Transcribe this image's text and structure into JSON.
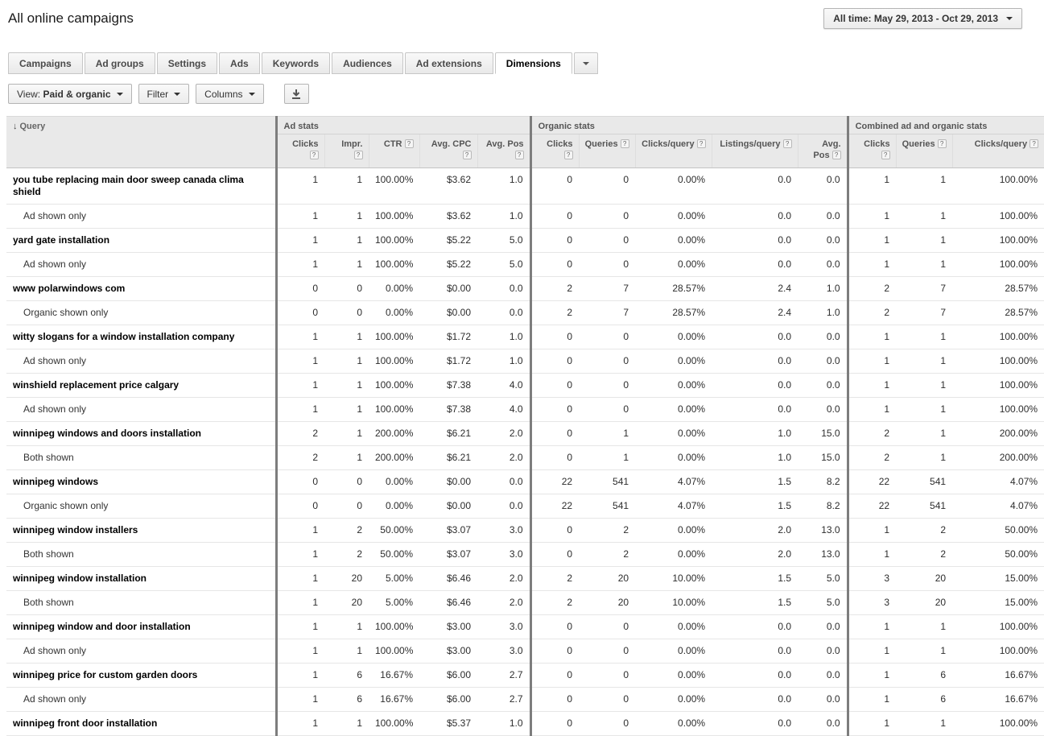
{
  "page": {
    "title": "All online campaigns",
    "date_range_label": "All time: May 29, 2013 - Oct 29, 2013"
  },
  "icons": {
    "sort_desc": "↓",
    "caret_down": "▾",
    "help": "?",
    "download": "download-icon"
  },
  "tabs": [
    {
      "label": "Campaigns",
      "selected": false
    },
    {
      "label": "Ad groups",
      "selected": false
    },
    {
      "label": "Settings",
      "selected": false
    },
    {
      "label": "Ads",
      "selected": false
    },
    {
      "label": "Keywords",
      "selected": false
    },
    {
      "label": "Audiences",
      "selected": false
    },
    {
      "label": "Ad extensions",
      "selected": false
    },
    {
      "label": "Dimensions",
      "selected": true
    },
    {
      "label": "▼",
      "selected": false,
      "is_more": true
    }
  ],
  "toolbar": {
    "view_label_prefix": "View: ",
    "view_value": "Paid & organic",
    "filter_label": "Filter",
    "columns_label": "Columns"
  },
  "table": {
    "query_header": "Query",
    "groups": [
      {
        "label": "Ad stats",
        "columns": [
          "Clicks",
          "Impr.",
          "CTR",
          "Avg. CPC",
          "Avg. Pos"
        ]
      },
      {
        "label": "Organic stats",
        "columns": [
          "Clicks",
          "Queries",
          "Clicks/query",
          "Listings/query",
          "Avg. Pos"
        ]
      },
      {
        "label": "Combined ad and organic stats",
        "columns": [
          "Clicks",
          "Queries",
          "Clicks/query"
        ]
      }
    ],
    "rows": [
      {
        "query": "you tube replacing main door sweep canada clima shield",
        "level": "query",
        "values": [
          "1",
          "1",
          "100.00%",
          "$3.62",
          "1.0",
          "0",
          "0",
          "0.00%",
          "0.0",
          "0.0",
          "1",
          "1",
          "100.00%"
        ]
      },
      {
        "query": "Ad shown only",
        "level": "segment",
        "values": [
          "1",
          "1",
          "100.00%",
          "$3.62",
          "1.0",
          "0",
          "0",
          "0.00%",
          "0.0",
          "0.0",
          "1",
          "1",
          "100.00%"
        ]
      },
      {
        "query": "yard gate installation",
        "level": "query",
        "values": [
          "1",
          "1",
          "100.00%",
          "$5.22",
          "5.0",
          "0",
          "0",
          "0.00%",
          "0.0",
          "0.0",
          "1",
          "1",
          "100.00%"
        ]
      },
      {
        "query": "Ad shown only",
        "level": "segment",
        "values": [
          "1",
          "1",
          "100.00%",
          "$5.22",
          "5.0",
          "0",
          "0",
          "0.00%",
          "0.0",
          "0.0",
          "1",
          "1",
          "100.00%"
        ]
      },
      {
        "query": "www polarwindows com",
        "level": "query",
        "values": [
          "0",
          "0",
          "0.00%",
          "$0.00",
          "0.0",
          "2",
          "7",
          "28.57%",
          "2.4",
          "1.0",
          "2",
          "7",
          "28.57%"
        ]
      },
      {
        "query": "Organic shown only",
        "level": "segment",
        "values": [
          "0",
          "0",
          "0.00%",
          "$0.00",
          "0.0",
          "2",
          "7",
          "28.57%",
          "2.4",
          "1.0",
          "2",
          "7",
          "28.57%"
        ]
      },
      {
        "query": "witty slogans for a window installation company",
        "level": "query",
        "values": [
          "1",
          "1",
          "100.00%",
          "$1.72",
          "1.0",
          "0",
          "0",
          "0.00%",
          "0.0",
          "0.0",
          "1",
          "1",
          "100.00%"
        ]
      },
      {
        "query": "Ad shown only",
        "level": "segment",
        "values": [
          "1",
          "1",
          "100.00%",
          "$1.72",
          "1.0",
          "0",
          "0",
          "0.00%",
          "0.0",
          "0.0",
          "1",
          "1",
          "100.00%"
        ]
      },
      {
        "query": "winshield replacement price calgary",
        "level": "query",
        "values": [
          "1",
          "1",
          "100.00%",
          "$7.38",
          "4.0",
          "0",
          "0",
          "0.00%",
          "0.0",
          "0.0",
          "1",
          "1",
          "100.00%"
        ]
      },
      {
        "query": "Ad shown only",
        "level": "segment",
        "values": [
          "1",
          "1",
          "100.00%",
          "$7.38",
          "4.0",
          "0",
          "0",
          "0.00%",
          "0.0",
          "0.0",
          "1",
          "1",
          "100.00%"
        ]
      },
      {
        "query": "winnipeg windows and doors installation",
        "level": "query",
        "values": [
          "2",
          "1",
          "200.00%",
          "$6.21",
          "2.0",
          "0",
          "1",
          "0.00%",
          "1.0",
          "15.0",
          "2",
          "1",
          "200.00%"
        ]
      },
      {
        "query": "Both shown",
        "level": "segment",
        "values": [
          "2",
          "1",
          "200.00%",
          "$6.21",
          "2.0",
          "0",
          "1",
          "0.00%",
          "1.0",
          "15.0",
          "2",
          "1",
          "200.00%"
        ]
      },
      {
        "query": "winnipeg windows",
        "level": "query",
        "values": [
          "0",
          "0",
          "0.00%",
          "$0.00",
          "0.0",
          "22",
          "541",
          "4.07%",
          "1.5",
          "8.2",
          "22",
          "541",
          "4.07%"
        ]
      },
      {
        "query": "Organic shown only",
        "level": "segment",
        "values": [
          "0",
          "0",
          "0.00%",
          "$0.00",
          "0.0",
          "22",
          "541",
          "4.07%",
          "1.5",
          "8.2",
          "22",
          "541",
          "4.07%"
        ]
      },
      {
        "query": "winnipeg window installers",
        "level": "query",
        "values": [
          "1",
          "2",
          "50.00%",
          "$3.07",
          "3.0",
          "0",
          "2",
          "0.00%",
          "2.0",
          "13.0",
          "1",
          "2",
          "50.00%"
        ]
      },
      {
        "query": "Both shown",
        "level": "segment",
        "values": [
          "1",
          "2",
          "50.00%",
          "$3.07",
          "3.0",
          "0",
          "2",
          "0.00%",
          "2.0",
          "13.0",
          "1",
          "2",
          "50.00%"
        ]
      },
      {
        "query": "winnipeg window installation",
        "level": "query",
        "values": [
          "1",
          "20",
          "5.00%",
          "$6.46",
          "2.0",
          "2",
          "20",
          "10.00%",
          "1.5",
          "5.0",
          "3",
          "20",
          "15.00%"
        ]
      },
      {
        "query": "Both shown",
        "level": "segment",
        "values": [
          "1",
          "20",
          "5.00%",
          "$6.46",
          "2.0",
          "2",
          "20",
          "10.00%",
          "1.5",
          "5.0",
          "3",
          "20",
          "15.00%"
        ]
      },
      {
        "query": "winnipeg window and door installation",
        "level": "query",
        "values": [
          "1",
          "1",
          "100.00%",
          "$3.00",
          "3.0",
          "0",
          "0",
          "0.00%",
          "0.0",
          "0.0",
          "1",
          "1",
          "100.00%"
        ]
      },
      {
        "query": "Ad shown only",
        "level": "segment",
        "values": [
          "1",
          "1",
          "100.00%",
          "$3.00",
          "3.0",
          "0",
          "0",
          "0.00%",
          "0.0",
          "0.0",
          "1",
          "1",
          "100.00%"
        ]
      },
      {
        "query": "winnipeg price for custom garden doors",
        "level": "query",
        "values": [
          "1",
          "6",
          "16.67%",
          "$6.00",
          "2.7",
          "0",
          "0",
          "0.00%",
          "0.0",
          "0.0",
          "1",
          "6",
          "16.67%"
        ]
      },
      {
        "query": "Ad shown only",
        "level": "segment",
        "values": [
          "1",
          "6",
          "16.67%",
          "$6.00",
          "2.7",
          "0",
          "0",
          "0.00%",
          "0.0",
          "0.0",
          "1",
          "6",
          "16.67%"
        ]
      },
      {
        "query": "winnipeg front door installation",
        "level": "query",
        "values": [
          "1",
          "1",
          "100.00%",
          "$5.37",
          "1.0",
          "0",
          "0",
          "0.00%",
          "0.0",
          "0.0",
          "1",
          "1",
          "100.00%"
        ]
      }
    ]
  }
}
